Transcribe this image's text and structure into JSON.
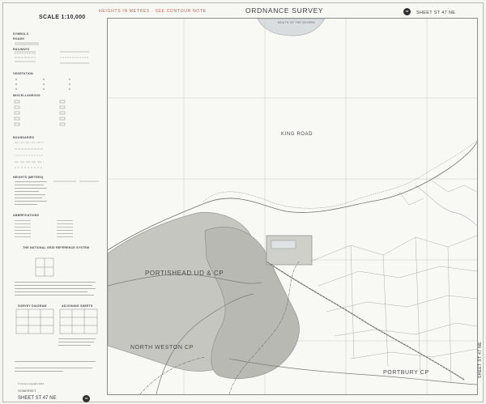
{
  "header": {
    "heights_note": "HEIGHTS IN METRES · SEE CONTOUR NOTE",
    "title": "ORDNANCE SURVEY",
    "sheet_number": "SHEET ST 47 NE",
    "logo_text": "OS"
  },
  "legend": {
    "scale": "SCALE 1:10,000",
    "headings": [
      "SYMBOLS",
      "ROADS",
      "RAILWAYS",
      "VEGETATION",
      "MISCELLANEOUS",
      "BOUNDARIES",
      "HEIGHTS (METRES)",
      "ABBREVIATIONS",
      "THE NATIONAL GRID REFERENCE SYSTEM",
      "SURVEY DIAGRAM",
      "ADJOINING SHEETS"
    ],
    "copyright": "© Crown copyright 1974",
    "county": "SOMERSET",
    "sheet_number": "SHEET ST 47 NE"
  },
  "map": {
    "estuary_label": "MOUTH OF THE SEVERN",
    "sea_label": "KING ROAD",
    "places": [
      "PORTISHEAD UD & CP",
      "NORTH WESTON CP",
      "PORTBURY CP"
    ]
  },
  "colors": {
    "ink": "#3d3d3d",
    "note_red": "#b26d5c",
    "water": "#d9dde0",
    "urban": "#b7b7b2"
  }
}
